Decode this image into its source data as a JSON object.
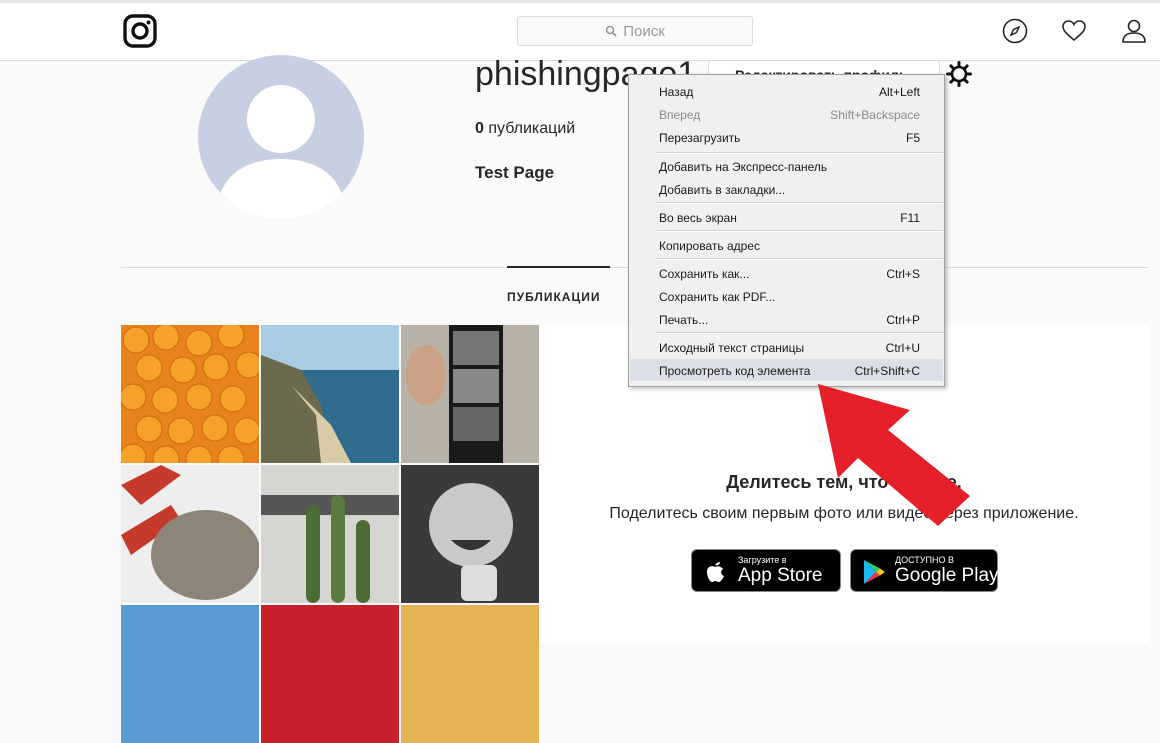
{
  "header": {
    "search_placeholder": "Поиск",
    "icons": [
      "instagram-logo-icon",
      "search-icon",
      "compass-icon",
      "heart-icon",
      "profile-icon"
    ]
  },
  "profile": {
    "username": "phishingpage1",
    "edit_button": "Редактировать профиль",
    "posts_count": "0",
    "posts_label": "публикаций",
    "full_name": "Test Page"
  },
  "tabs": {
    "posts": "ПУБЛИКАЦИИ"
  },
  "share": {
    "title": "Делитесь тем, что видите.",
    "subtitle": "Поделитесь своим первым фото или видео через приложение.",
    "appstore_small": "Загрузите в",
    "appstore_big": "App Store",
    "googleplay_small": "ДОСТУПНО В",
    "googleplay_big": "Google Play"
  },
  "context_menu": {
    "items": [
      {
        "label": "Назад",
        "shortcut": "Alt+Left",
        "disabled": false
      },
      {
        "label": "Вперед",
        "shortcut": "Shift+Backspace",
        "disabled": true
      },
      {
        "label": "Перезагрузить",
        "shortcut": "F5",
        "disabled": false
      },
      {
        "label": "Добавить на Экспресс-панель",
        "shortcut": "",
        "disabled": false
      },
      {
        "label": "Добавить в закладки...",
        "shortcut": "",
        "disabled": false
      },
      {
        "label": "Во весь экран",
        "shortcut": "F11",
        "disabled": false
      },
      {
        "label": "Копировать адрес",
        "shortcut": "",
        "disabled": false
      },
      {
        "label": "Сохранить как...",
        "shortcut": "Ctrl+S",
        "disabled": false
      },
      {
        "label": "Сохранить как PDF...",
        "shortcut": "",
        "disabled": false
      },
      {
        "label": "Печать...",
        "shortcut": "Ctrl+P",
        "disabled": false
      },
      {
        "label": "Исходный текст страницы",
        "shortcut": "Ctrl+U",
        "disabled": false
      },
      {
        "label": "Просмотреть код элемента",
        "shortcut": "Ctrl+Shift+C",
        "disabled": false,
        "highlighted": true
      }
    ]
  },
  "colors": {
    "accent_arrow": "#e5202a",
    "menu_highlight": "#dcdfe8",
    "avatar_bg": "#c7cfe3"
  }
}
